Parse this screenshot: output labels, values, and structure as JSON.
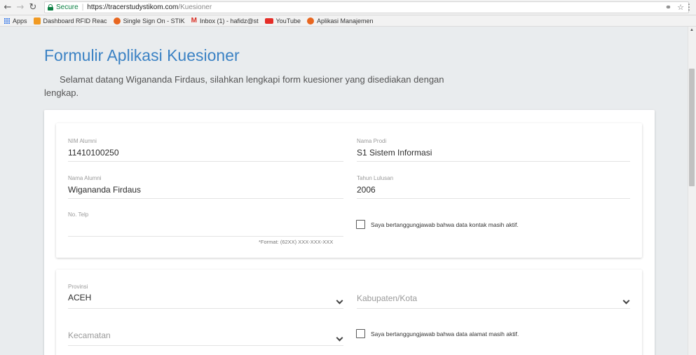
{
  "browser": {
    "secure_label": "Secure",
    "url_host": "https://tracerstudystikom.com",
    "url_path": "/Kuesioner",
    "key_icon": "key-icon",
    "star_icon": "star-icon",
    "menu_icon": "kebab-menu-icon"
  },
  "bookmarks": [
    {
      "label": "Apps",
      "icon": "apps-grid-icon"
    },
    {
      "label": "Dashboard RFID Reac",
      "icon": "dashboard-icon",
      "color": "#f19a22"
    },
    {
      "label": "Single Sign On - STIK",
      "icon": "stikom-logo-icon",
      "color": "#e8661f"
    },
    {
      "label": "Inbox (1) - hafidz@st",
      "icon": "gmail-icon",
      "color": "#d93025"
    },
    {
      "label": "YouTube",
      "icon": "youtube-icon",
      "color": "#e52d27"
    },
    {
      "label": "Aplikasi Manajemen",
      "icon": "stikom-logo-icon",
      "color": "#e8661f"
    }
  ],
  "page": {
    "title": "Formulir Aplikasi Kuesioner",
    "welcome": "Selamat datang Wigananda Firdaus, silahkan lengkapi form kuesioner yang disediakan dengan lengkap."
  },
  "section1": {
    "nim_label": "NIM Alumni",
    "nim_value": "11410100250",
    "prodi_label": "Nama Prodi",
    "prodi_value": "S1 Sistem Informasi",
    "nama_label": "Nama Alumni",
    "nama_value": "Wigananda Firdaus",
    "tahun_label": "Tahun Lulusan",
    "tahun_value": "2006",
    "telp_label": "No. Telp",
    "telp_value": "",
    "telp_hint": "*Format: (62XX) XXX-XXX-XXX",
    "contact_check_label": "Saya bertanggungjawab bahwa data kontak masih aktif."
  },
  "section2": {
    "provinsi_label": "Provinsi",
    "provinsi_value": "ACEH",
    "kabupaten_placeholder": "Kabupaten/Kota",
    "kecamatan_placeholder": "Kecamatan",
    "address_check_label": "Saya bertanggungjawab bahwa data alamat masih aktif."
  },
  "colors": {
    "title": "#3b82c4",
    "secure": "#0b8043",
    "page_bg": "#e9ecee"
  }
}
